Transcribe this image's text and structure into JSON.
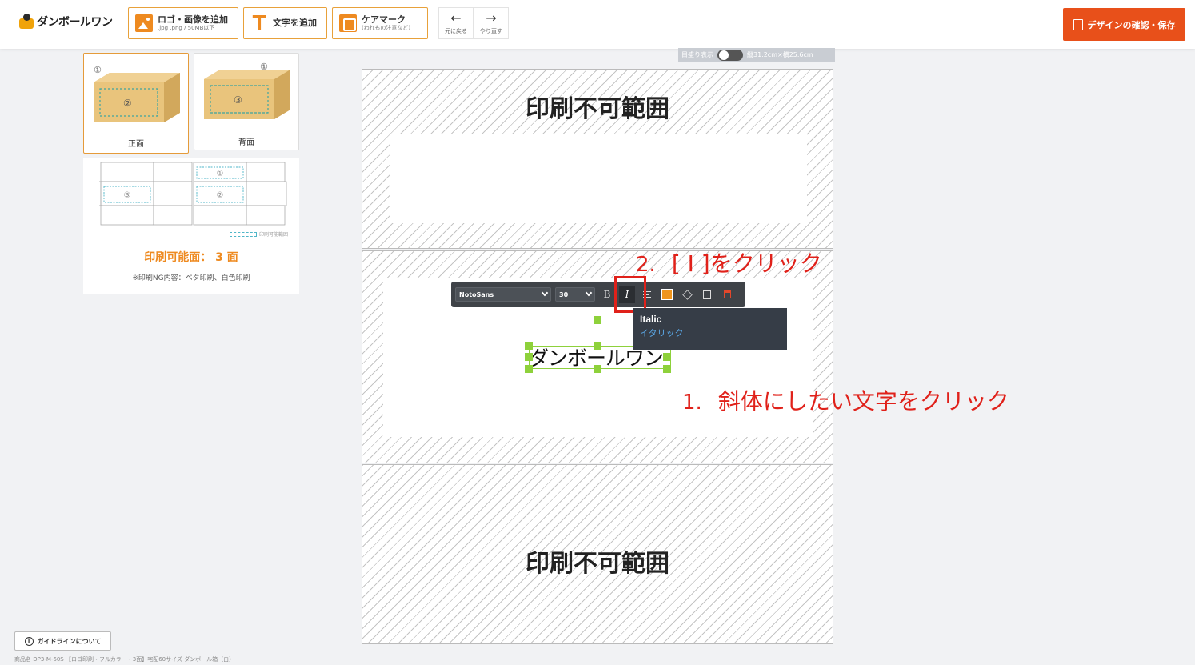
{
  "header": {
    "logo_text": "ダンボールワン",
    "add_logo": {
      "label": "ロゴ・画像を追加",
      "sub": ".jpg .png / 50MB以下"
    },
    "add_text": {
      "label": "文字を追加"
    },
    "care_mark": {
      "label": "ケアマーク",
      "sub": "(われもの注意など)"
    },
    "undo": {
      "label": "元に戻る",
      "glyph": "←"
    },
    "redo": {
      "label": "やり直す",
      "glyph": "→"
    },
    "save_label": "デザインの確認・保存"
  },
  "faces": [
    {
      "label": "正面",
      "selected": true,
      "markers": [
        "①",
        "②"
      ]
    },
    {
      "label": "背面",
      "selected": false,
      "markers": [
        "①",
        "③"
      ]
    }
  ],
  "guide": {
    "net_markers": [
      "①",
      "③",
      "②"
    ],
    "legend": "印刷可能範囲",
    "print_count": "印刷可能面： 3 面",
    "note": "※印刷NG内容：ベタ印刷、白色印刷"
  },
  "guideline_button": "ガイドラインについて",
  "info_icon": "i",
  "product_name": "商品名 DP3-M-60S 【ロゴ印刷・フルカラー・3面】宅配60サイズ ダンボール箱（白）",
  "canvas": {
    "ruler_label": "目盛り表示",
    "dimensions": "縦31.2cm×横25.6cm",
    "no_print_top": "印刷不可範囲",
    "no_print_bottom": "印刷不可範囲",
    "selected_text": "ダンボールワン"
  },
  "toolbar": {
    "font": "NotoSans",
    "size": "30",
    "bold": "B",
    "italic": "I"
  },
  "tooltip": {
    "en": "Italic",
    "ja": "イタリック"
  },
  "annotations": {
    "step1_num": "1.",
    "step1_text": "斜体にしたい文字をクリック",
    "step2_num": "2.",
    "step2_text": "[ I ]をクリック"
  },
  "colors": {
    "accent": "#ee8a20",
    "save": "#e8501a",
    "annotation": "#e0211a",
    "selection": "#8ed13b"
  }
}
